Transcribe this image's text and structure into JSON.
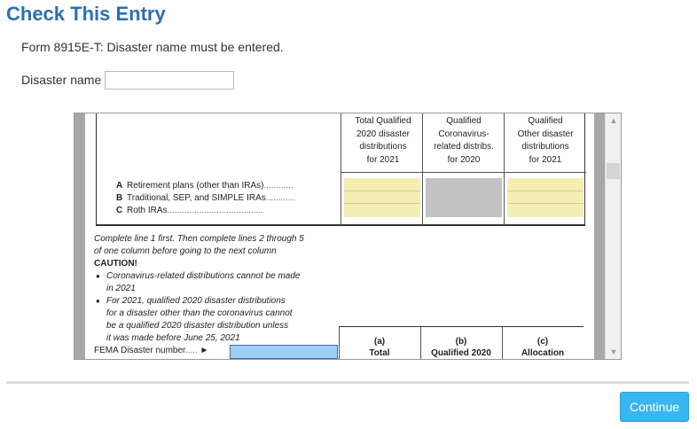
{
  "header": {
    "title": "Check This Entry"
  },
  "message": "Form 8915E-T: Disaster name must be entered.",
  "field": {
    "label": "Disaster name",
    "value": ""
  },
  "form": {
    "column_headers": [
      {
        "lines": [
          "Total Qualified",
          "2020 disaster",
          "distributions",
          "for 2021"
        ]
      },
      {
        "lines": [
          "Qualified",
          "Coronavirus-",
          "related distribs.",
          "for 2020"
        ]
      },
      {
        "lines": [
          "Qualified",
          "Other disaster",
          "distributions",
          "for 2021"
        ]
      }
    ],
    "rows": [
      {
        "letter": "A",
        "label": "Retirement plans (other than IRAs)",
        "dots": "............"
      },
      {
        "letter": "B",
        "label": "Traditional, SEP, and SIMPLE IRAs",
        "dots": "............"
      },
      {
        "letter": "C",
        "label": "Roth IRAs",
        "dots": "......................................."
      }
    ],
    "instructions": {
      "line1": "Complete line 1 first. Then complete lines 2 through 5",
      "line2": "of one column before going to the next column",
      "caution": "CAUTION!",
      "bullet1_a": "Coronavirus-related distributions cannot be made",
      "bullet1_b": "in 2021",
      "bullet2_a": "For 2021, qualified 2020 disaster distributions",
      "bullet2_b": "for a disaster other than the coronavirus cannot",
      "bullet2_c": "be a qualified 2020 disaster distribution unless",
      "bullet2_d": "it was made before June 25, 2021"
    },
    "fema": {
      "label": "FEMA Disaster number",
      "dots": ".....",
      "arrow": "►"
    },
    "bottom_columns": [
      {
        "letter": "(a)",
        "label": "Total"
      },
      {
        "letter": "(b)",
        "label": "Qualified 2020"
      },
      {
        "letter": "(c)",
        "label": "Allocation"
      }
    ]
  },
  "scrollbar": {
    "up_icon": "▲",
    "down_icon": "▼"
  },
  "footer": {
    "continue_label": "Continue"
  },
  "colors": {
    "title": "#2a6fb5",
    "button": "#39b5f0",
    "fema_field": "#9ecef5",
    "input_cell": "#f5eeb4"
  }
}
